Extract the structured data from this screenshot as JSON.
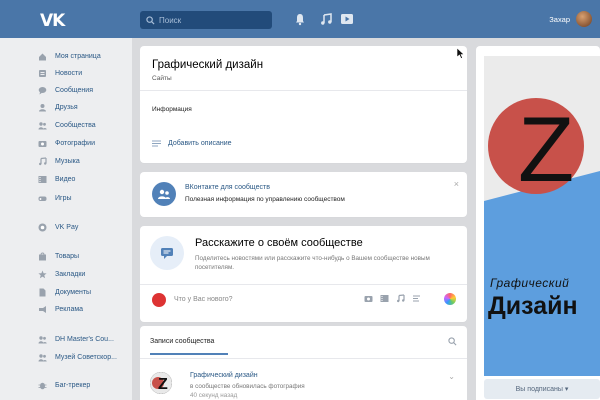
{
  "header": {
    "logo": "VK",
    "search_placeholder": "Поиск",
    "user_name": "Захар"
  },
  "sidebar": {
    "items": [
      {
        "label": "Моя страница",
        "icon": "home-icon"
      },
      {
        "label": "Новости",
        "icon": "news-icon"
      },
      {
        "label": "Сообщения",
        "icon": "chat-icon"
      },
      {
        "label": "Друзья",
        "icon": "user-icon"
      },
      {
        "label": "Сообщества",
        "icon": "users-icon"
      },
      {
        "label": "Фотографии",
        "icon": "camera-icon"
      },
      {
        "label": "Музыка",
        "icon": "music-icon"
      },
      {
        "label": "Видео",
        "icon": "video-icon"
      },
      {
        "label": "Игры",
        "icon": "gamepad-icon"
      },
      {
        "label": "VK Pay",
        "icon": "pay-icon"
      },
      {
        "label": "Товары",
        "icon": "goods-icon"
      },
      {
        "label": "Закладки",
        "icon": "star-icon"
      },
      {
        "label": "Документы",
        "icon": "document-icon"
      },
      {
        "label": "Реклама",
        "icon": "ads-icon"
      },
      {
        "label": "DH Master's Cou...",
        "icon": "users-icon"
      },
      {
        "label": "Музей Советскор...",
        "icon": "users-icon"
      },
      {
        "label": "Баг-трекер",
        "icon": "bug-icon"
      }
    ]
  },
  "group": {
    "title": "Графический дизайн",
    "subtitle": "Сайты",
    "info_label": "Информация",
    "add_description": "Добавить описание"
  },
  "business": {
    "title": "ВКонтакте для сообществ",
    "subtitle": "Полезная информация по управлению сообществом",
    "close": "×"
  },
  "tell": {
    "title": "Расскажите о своём сообществе",
    "subtitle": "Поделитесь новостями или расскажите что-нибудь о Вашем сообществе новым посетителям.",
    "post_placeholder": "Что у Вас нового?"
  },
  "wall": {
    "tab": "Записи сообщества",
    "post_author": "Графический дизайн",
    "post_text": "в сообществе обновилась фотография",
    "post_time": "40 секунд назад"
  },
  "cover": {
    "letter": "Z",
    "line1": "Графический",
    "line2": "Дизайн",
    "subscribed_button": "Вы подписаны ▾"
  },
  "colors": {
    "header_bg": "#4a76a8",
    "link": "#2a5885",
    "cover_red": "#c8514a",
    "cover_blue": "#5d9ede"
  }
}
